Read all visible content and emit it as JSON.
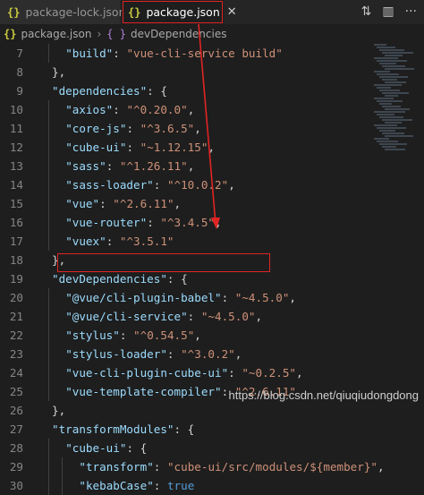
{
  "tabs": [
    {
      "label": "package-lock.json",
      "icon": "json-braces-icon",
      "active": false
    },
    {
      "label": "package.json",
      "icon": "json-braces-icon",
      "active": true,
      "close": "✕"
    }
  ],
  "tab_actions": {
    "compare": "⇅",
    "split": "▥",
    "more": "···"
  },
  "breadcrumb": {
    "file": "package.json",
    "separator": "›",
    "node_icon": "{ }",
    "node": "devDependencies"
  },
  "icons": {
    "json": "{}"
  },
  "lines": [
    {
      "n": "7",
      "indent": 2,
      "tokens": [
        [
          "k",
          "\"build\""
        ],
        [
          "p",
          ": "
        ],
        [
          "s",
          "\"vue-cli-service build\""
        ]
      ]
    },
    {
      "n": "8",
      "indent": 1,
      "tokens": [
        [
          "p",
          "},"
        ]
      ]
    },
    {
      "n": "9",
      "indent": 1,
      "tokens": [
        [
          "k",
          "\"dependencies\""
        ],
        [
          "p",
          ": {"
        ]
      ]
    },
    {
      "n": "10",
      "indent": 2,
      "tokens": [
        [
          "k",
          "\"axios\""
        ],
        [
          "p",
          ": "
        ],
        [
          "s",
          "\"^0.20.0\""
        ],
        [
          "p",
          ","
        ]
      ]
    },
    {
      "n": "11",
      "indent": 2,
      "tokens": [
        [
          "k",
          "\"core-js\""
        ],
        [
          "p",
          ": "
        ],
        [
          "s",
          "\"^3.6.5\""
        ],
        [
          "p",
          ","
        ]
      ]
    },
    {
      "n": "12",
      "indent": 2,
      "tokens": [
        [
          "k",
          "\"cube-ui\""
        ],
        [
          "p",
          ": "
        ],
        [
          "s",
          "\"~1.12.15\""
        ],
        [
          "p",
          ","
        ]
      ]
    },
    {
      "n": "13",
      "indent": 2,
      "tokens": [
        [
          "k",
          "\"sass\""
        ],
        [
          "p",
          ": "
        ],
        [
          "s",
          "\"^1.26.11\""
        ],
        [
          "p",
          ","
        ]
      ]
    },
    {
      "n": "14",
      "indent": 2,
      "tokens": [
        [
          "k",
          "\"sass-loader\""
        ],
        [
          "p",
          ": "
        ],
        [
          "s",
          "\"^10.0.2\""
        ],
        [
          "p",
          ","
        ]
      ]
    },
    {
      "n": "15",
      "indent": 2,
      "tokens": [
        [
          "k",
          "\"vue\""
        ],
        [
          "p",
          ": "
        ],
        [
          "s",
          "\"^2.6.11\""
        ],
        [
          "p",
          ","
        ]
      ]
    },
    {
      "n": "16",
      "indent": 2,
      "tokens": [
        [
          "k",
          "\"vue-router\""
        ],
        [
          "p",
          ": "
        ],
        [
          "s",
          "\"^3.4.5\""
        ],
        [
          "p",
          ","
        ]
      ]
    },
    {
      "n": "17",
      "indent": 2,
      "tokens": [
        [
          "k",
          "\"vuex\""
        ],
        [
          "p",
          ": "
        ],
        [
          "s",
          "\"^3.5.1\""
        ]
      ]
    },
    {
      "n": "18",
      "indent": 1,
      "tokens": [
        [
          "p",
          "},"
        ]
      ]
    },
    {
      "n": "19",
      "indent": 1,
      "tokens": [
        [
          "k",
          "\"devDependencies\""
        ],
        [
          "p",
          ": {"
        ]
      ]
    },
    {
      "n": "20",
      "indent": 2,
      "tokens": [
        [
          "k",
          "\"@vue/cli-plugin-babel\""
        ],
        [
          "p",
          ": "
        ],
        [
          "s",
          "\"~4.5.0\""
        ],
        [
          "p",
          ","
        ]
      ]
    },
    {
      "n": "21",
      "indent": 2,
      "tokens": [
        [
          "k",
          "\"@vue/cli-service\""
        ],
        [
          "p",
          ": "
        ],
        [
          "s",
          "\"~4.5.0\""
        ],
        [
          "p",
          ","
        ]
      ]
    },
    {
      "n": "22",
      "indent": 2,
      "tokens": [
        [
          "k",
          "\"stylus\""
        ],
        [
          "p",
          ": "
        ],
        [
          "s",
          "\"^0.54.5\""
        ],
        [
          "p",
          ","
        ]
      ]
    },
    {
      "n": "23",
      "indent": 2,
      "tokens": [
        [
          "k",
          "\"stylus-loader\""
        ],
        [
          "p",
          ": "
        ],
        [
          "s",
          "\"^3.0.2\""
        ],
        [
          "p",
          ","
        ]
      ]
    },
    {
      "n": "24",
      "indent": 2,
      "tokens": [
        [
          "k",
          "\"vue-cli-plugin-cube-ui\""
        ],
        [
          "p",
          ": "
        ],
        [
          "s",
          "\"~0.2.5\""
        ],
        [
          "p",
          ","
        ]
      ]
    },
    {
      "n": "25",
      "indent": 2,
      "tokens": [
        [
          "k",
          "\"vue-template-compiler\""
        ],
        [
          "p",
          ": "
        ],
        [
          "s",
          "\"^2.6.11\""
        ]
      ]
    },
    {
      "n": "26",
      "indent": 1,
      "tokens": [
        [
          "p",
          "},"
        ]
      ]
    },
    {
      "n": "27",
      "indent": 1,
      "tokens": [
        [
          "k",
          "\"transformModules\""
        ],
        [
          "p",
          ": {"
        ]
      ]
    },
    {
      "n": "28",
      "indent": 2,
      "tokens": [
        [
          "k",
          "\"cube-ui\""
        ],
        [
          "p",
          ": {"
        ]
      ]
    },
    {
      "n": "29",
      "indent": 3,
      "tokens": [
        [
          "k",
          "\"transform\""
        ],
        [
          "p",
          ": "
        ],
        [
          "s",
          "\"cube-ui/src/modules/${member}\""
        ],
        [
          "p",
          ","
        ]
      ]
    },
    {
      "n": "30",
      "indent": 3,
      "tokens": [
        [
          "k",
          "\"kebabCase\""
        ],
        [
          "p",
          ": "
        ],
        [
          "b",
          "true"
        ]
      ]
    }
  ],
  "watermark": "https://blog.csdn.net/qiuqiudongdong",
  "colors": {
    "highlight": "#e02424",
    "key": "#9cdcfe",
    "string": "#ce9178",
    "bool": "#569cd6"
  }
}
